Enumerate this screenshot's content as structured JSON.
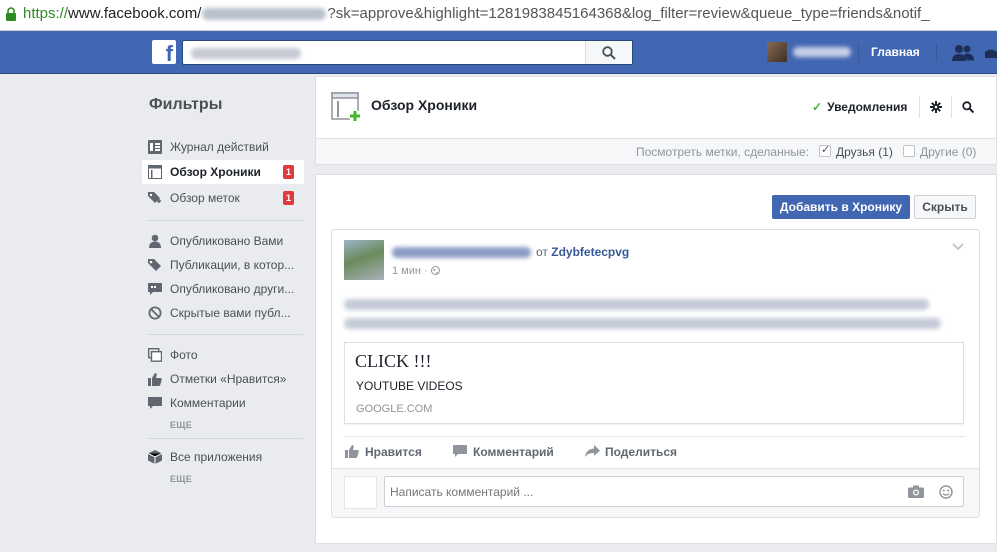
{
  "browser": {
    "url_scheme": "https://",
    "url_host": "www.facebook.com/",
    "url_rest": "?sk=approve&highlight=1281983845164368&log_filter=review&queue_type=friends&notif_"
  },
  "topbar": {
    "search_value": "",
    "home_label": "Главная"
  },
  "filters": {
    "title": "Фильтры",
    "items": [
      {
        "label": "Журнал действий",
        "icon": "activity-log-icon"
      },
      {
        "label": "Обзор Хроники",
        "icon": "timeline-review-icon",
        "badge": "1",
        "active": true
      },
      {
        "label": "Обзор меток",
        "icon": "tag-review-icon",
        "badge": "1"
      },
      {
        "label": "Опубликовано Вами",
        "icon": "person-icon"
      },
      {
        "label": "Публикации, в котор...",
        "icon": "tag-icon"
      },
      {
        "label": "Опубликовано други...",
        "icon": "speech-bubble-icon"
      },
      {
        "label": "Скрытые вами публ...",
        "icon": "hidden-icon"
      },
      {
        "label": "Фото",
        "icon": "photos-icon"
      },
      {
        "label": "Отметки «Нравится»",
        "icon": "like-icon"
      },
      {
        "label": "Комментарии",
        "icon": "comment-icon"
      },
      {
        "label": "Все приложения",
        "icon": "apps-cube-icon"
      }
    ],
    "more_label": "ЕЩЕ"
  },
  "header": {
    "title": "Обзор Хроники",
    "notifications_label": "Уведомления",
    "filter_label": "Посмотреть метки, сделанные:",
    "friends_option": "Друзья (1)",
    "others_option": "Другие (0)"
  },
  "actions": {
    "add_label": "Добавить в Хронику",
    "hide_label": "Скрыть"
  },
  "post": {
    "from_word": "от",
    "from_name": "Zdybfetecpvg",
    "time": "1 мин ·",
    "link_title": "CLICK !!!",
    "link_desc": "YOUTUBE VIDEOS",
    "link_domain": "GOOGLE.COM",
    "like_label": "Нравится",
    "comment_label": "Комментарий",
    "share_label": "Поделиться",
    "comment_placeholder": "Написать комментарий ..."
  },
  "colors": {
    "brand_blue": "#4267b2",
    "badge_red": "#e0393e",
    "check_green": "#42b72a"
  }
}
